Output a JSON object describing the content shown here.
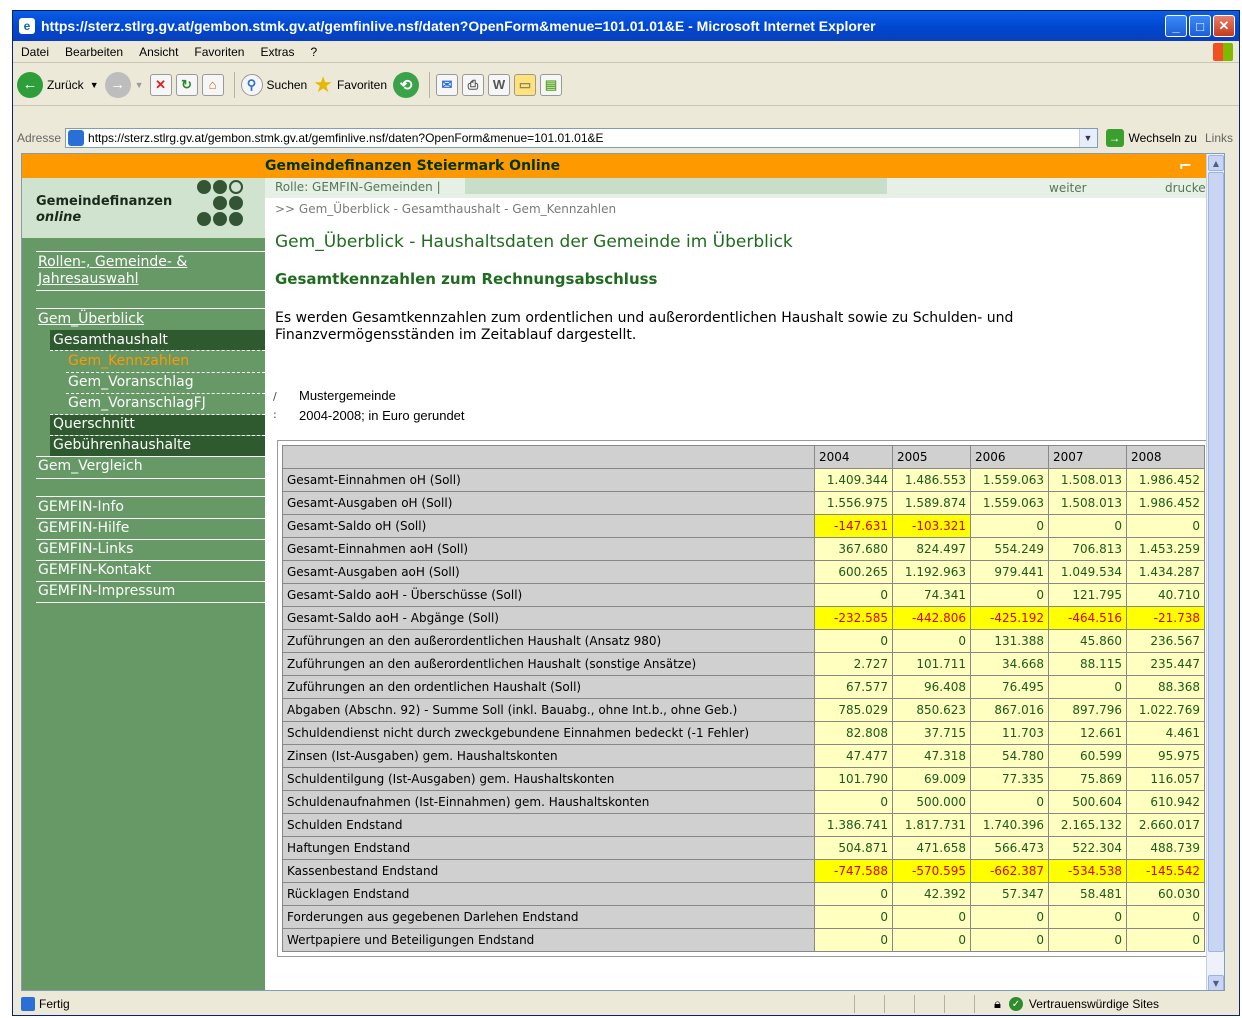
{
  "window": {
    "title": "https://sterz.stlrg.gv.at/gembon.stmk.gv.at/gemfinlive.nsf/daten?OpenForm&menue=101.01.01&E - Microsoft Internet Explorer"
  },
  "menu": [
    "Datei",
    "Bearbeiten",
    "Ansicht",
    "Favoriten",
    "Extras",
    "?"
  ],
  "toolbar": {
    "back_label": "Zurück",
    "search_label": "Suchen",
    "favorites_label": "Favoriten"
  },
  "address": {
    "label": "Adresse",
    "url": "https://sterz.stlrg.gv.at/gembon.stmk.gv.at/gemfinlive.nsf/daten?OpenForm&menue=101.01.01&E",
    "go_label": "Wechseln zu",
    "links_label": "Links"
  },
  "page": {
    "header_title": "Gemeindefinanzen Steiermark Online",
    "logo_title": "Gemeindefinanzen",
    "logo_sub": "online",
    "role_text": "Rolle: GEMFIN-Gemeinden  |",
    "weiter": "weiter",
    "drucken": "drucken",
    "breadcrumb": ">> Gem_Überblick  -  Gesamthaushalt  -  Gem_Kennzahlen",
    "heading": "Gem_Überblick - Haushaltsdaten der Gemeinde im Überblick",
    "subheading": "Gesamtkennzahlen zum Rechnungsabschluss",
    "intro": "Es werden Gesamtkennzahlen zum ordentlichen und außerordentlichen Haushalt sowie zu Schulden- und Finanzvermögensständen im Zeitablauf dargestellt.",
    "meta_line1": "Mustergemeinde",
    "meta_line2": "2004-2008; in Euro gerundet"
  },
  "sidebar": {
    "rollen": "Rollen-, Gemeinde- &",
    "rollen2": "Jahresauswahl",
    "gem_ueberblick": "Gem_Überblick",
    "gesamthaushalt": "Gesamthaushalt",
    "gem_kennzahlen": "Gem_Kennzahlen",
    "gem_voranschlag": "Gem_Voranschlag",
    "gem_voranschlagfj": "Gem_VoranschlagFJ",
    "querschnitt": "Querschnitt",
    "gebuehren": "Gebührenhaushalte",
    "gem_vergleich": "Gem_Vergleich",
    "info": "GEMFIN-Info",
    "hilfe": "GEMFIN-Hilfe",
    "links": "GEMFIN-Links",
    "kontakt": "GEMFIN-Kontakt",
    "impressum": "GEMFIN-Impressum"
  },
  "table": {
    "years": [
      "2004",
      "2005",
      "2006",
      "2007",
      "2008"
    ],
    "rows": [
      {
        "label": "Gesamt-Einnahmen oH (Soll)",
        "values": [
          "1.409.344",
          "1.486.553",
          "1.559.063",
          "1.508.013",
          "1.986.452"
        ]
      },
      {
        "label": "Gesamt-Ausgaben oH (Soll)",
        "values": [
          "1.556.975",
          "1.589.874",
          "1.559.063",
          "1.508.013",
          "1.986.452"
        ]
      },
      {
        "label": "Gesamt-Saldo oH (Soll)",
        "values": [
          "-147.631",
          "-103.321",
          "0",
          "0",
          "0"
        ]
      },
      {
        "label": "Gesamt-Einnahmen aoH (Soll)",
        "values": [
          "367.680",
          "824.497",
          "554.249",
          "706.813",
          "1.453.259"
        ]
      },
      {
        "label": "Gesamt-Ausgaben aoH (Soll)",
        "values": [
          "600.265",
          "1.192.963",
          "979.441",
          "1.049.534",
          "1.434.287"
        ]
      },
      {
        "label": "Gesamt-Saldo aoH - Überschüsse (Soll)",
        "values": [
          "0",
          "74.341",
          "0",
          "121.795",
          "40.710"
        ]
      },
      {
        "label": "Gesamt-Saldo aoH - Abgänge (Soll)",
        "values": [
          "-232.585",
          "-442.806",
          "-425.192",
          "-464.516",
          "-21.738"
        ]
      },
      {
        "label": "Zuführungen an den außerordentlichen Haushalt (Ansatz 980)",
        "values": [
          "0",
          "0",
          "131.388",
          "45.860",
          "236.567"
        ]
      },
      {
        "label": "Zuführungen an den außerordentlichen Haushalt (sonstige Ansätze)",
        "values": [
          "2.727",
          "101.711",
          "34.668",
          "88.115",
          "235.447"
        ]
      },
      {
        "label": "Zuführungen an den ordentlichen Haushalt (Soll)",
        "values": [
          "67.577",
          "96.408",
          "76.495",
          "0",
          "88.368"
        ]
      },
      {
        "label": "Abgaben (Abschn. 92) - Summe Soll (inkl. Bauabg., ohne Int.b., ohne Geb.)",
        "values": [
          "785.029",
          "850.623",
          "867.016",
          "897.796",
          "1.022.769"
        ]
      },
      {
        "label": "Schuldendienst nicht durch zweckgebundene Einnahmen bedeckt (-1 Fehler)",
        "values": [
          "82.808",
          "37.715",
          "11.703",
          "12.661",
          "4.461"
        ]
      },
      {
        "label": "Zinsen (Ist-Ausgaben) gem. Haushaltskonten",
        "values": [
          "47.477",
          "47.318",
          "54.780",
          "60.599",
          "95.975"
        ]
      },
      {
        "label": "Schuldentilgung (Ist-Ausgaben) gem. Haushaltskonten",
        "values": [
          "101.790",
          "69.009",
          "77.335",
          "75.869",
          "116.057"
        ]
      },
      {
        "label": "Schuldenaufnahmen (Ist-Einnahmen) gem. Haushaltskonten",
        "values": [
          "0",
          "500.000",
          "0",
          "500.604",
          "610.942"
        ]
      },
      {
        "label": "Schulden Endstand",
        "values": [
          "1.386.741",
          "1.817.731",
          "1.740.396",
          "2.165.132",
          "2.660.017"
        ]
      },
      {
        "label": "Haftungen Endstand",
        "values": [
          "504.871",
          "471.658",
          "566.473",
          "522.304",
          "488.739"
        ]
      },
      {
        "label": "Kassenbestand Endstand",
        "values": [
          "-747.588",
          "-570.595",
          "-662.387",
          "-534.538",
          "-145.542"
        ]
      },
      {
        "label": "Rücklagen Endstand",
        "values": [
          "0",
          "42.392",
          "57.347",
          "58.481",
          "60.030"
        ]
      },
      {
        "label": "Forderungen aus gegebenen Darlehen Endstand",
        "values": [
          "0",
          "0",
          "0",
          "0",
          "0"
        ]
      },
      {
        "label": "Wertpapiere und Beteiligungen Endstand",
        "values": [
          "0",
          "0",
          "0",
          "0",
          "0"
        ]
      }
    ]
  },
  "status": {
    "left": "Fertig",
    "zone": "Vertrauenswürdige Sites"
  },
  "colors": {
    "header_orange": "#ff9900",
    "sidebar_green": "#669966",
    "heading_green": "#1f6b1f",
    "negative_bg": "#ffff00",
    "negative_text": "#e00000",
    "cell_bg": "#ffffc0"
  }
}
